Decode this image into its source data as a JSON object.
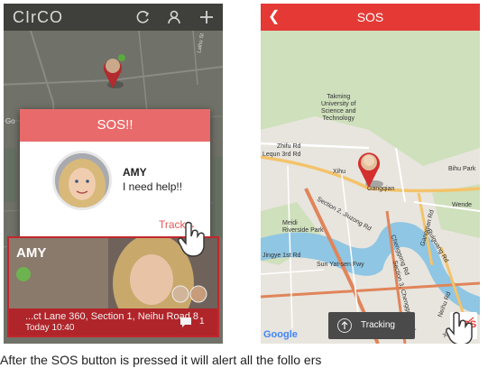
{
  "left_app": {
    "logo": "CIrCO",
    "map_labels": [
      "Go",
      "Laihu St"
    ],
    "modal": {
      "title": "SOS!!",
      "name": "AMY",
      "message": "I need help!!",
      "track_label": "Track→"
    },
    "card": {
      "name": "AMY",
      "address": "...ct Lane 360, Section 1, Neihu Road 8",
      "time": "Today 10:40",
      "message_count": "1"
    }
  },
  "right_app": {
    "title": "SOS",
    "map_labels": {
      "takming": "Takming\nUniversity of\nScience and\nTechnology",
      "zhifu": "Zhifu Rd",
      "lequn": "Lequn 3rd Rd",
      "xihu": "Xihu",
      "gangqian": "Gangqian",
      "bihu": "Bihu Park",
      "wende": "Wende",
      "meidi": "Meidi\nRiverside Park",
      "jingye": "Jingye 1st Rd",
      "sunyatsen": "Sun Yat-sen Fwy",
      "section2": "Section 2, Jiuzong Rd",
      "gangqian_rd": "Gangqian Rd",
      "ruiguang": "Ruiguang Rd",
      "chenggong": "Chenggong Rd",
      "neihu": "Neihu Rd",
      "section3": "Section 3, Chenggong Rd",
      "xinhu": "Xinhu 2nd Rd"
    },
    "google": "Google",
    "tracking_label": "Tracking",
    "sos_label": "SOS"
  },
  "caption": "After the SOS button is pressed it will alert all the follo        ers"
}
